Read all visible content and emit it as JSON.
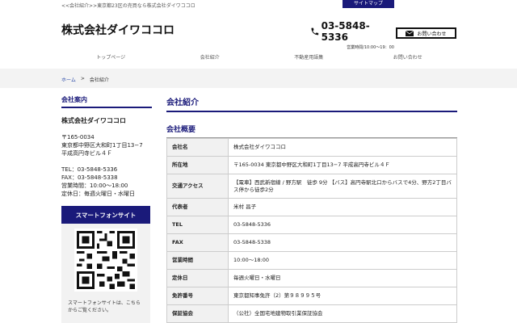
{
  "header": {
    "topline": "<<会社紹介>>東京都23区の売買なら株式会社ダイワココロ",
    "sitemap_label": "サイトマップ",
    "logo": "株式会社ダイワココロ",
    "phone": "03-5848-5336",
    "hours": "営業時間/10:00〜19：00",
    "contact_label": "お問い合わせ"
  },
  "nav": {
    "items": [
      "トップページ",
      "会社紹介",
      "不動産用語集",
      "お問い合わせ"
    ]
  },
  "breadcrumb": {
    "home": "ホーム",
    "sep": ">",
    "current": "会社紹介"
  },
  "sidebar": {
    "heading": "会社案内",
    "company": "株式会社ダイワココロ",
    "postal": "〒165-0034",
    "address1": "東京都中野区大和町1丁目13−7",
    "address2": "平成高円寺ビル４Ｆ",
    "tel": "TEL：03-5848-5336",
    "fax": "FAX：03-5848-5338",
    "hours": "営業時間：10:00〜18:00",
    "holiday": "定休日：毎週火曜日・水曜日",
    "sp_button": "スマートフォンサイト",
    "qr_caption": "スマートフォンサイトは、こちらからご覧ください。"
  },
  "main": {
    "title": "会社紹介",
    "subtitle": "会社概要",
    "rows": [
      {
        "key": "会社名",
        "value": "株式会社ダイワココロ"
      },
      {
        "key": "所在地",
        "value": "〒165-0034 東京都中野区大和町1丁目13−7 平成高円寺ビル４Ｆ"
      },
      {
        "key": "交通アクセス",
        "value": "【電車】西武新宿線 / 野方駅　徒歩 9分 【バス】高円寺駅北口からバスで4分、野方2丁目バス停から徒歩2分"
      },
      {
        "key": "代表者",
        "value": "米村 昌子"
      },
      {
        "key": "TEL",
        "value": "03-5848-5336"
      },
      {
        "key": "FAX",
        "value": "03-5848-5338"
      },
      {
        "key": "営業時間",
        "value": "10:00〜18:00"
      },
      {
        "key": "定休日",
        "value": "毎週火曜日・水曜日"
      },
      {
        "key": "免許番号",
        "value": "東京都知事免許（2）第９８９９５号"
      },
      {
        "key": "保証協会",
        "value": "（公社）全国宅地建物取引業保証協会"
      }
    ]
  },
  "icons": {
    "phone": "phone-icon",
    "mail": "mail-icon",
    "qr": "qr-code"
  }
}
